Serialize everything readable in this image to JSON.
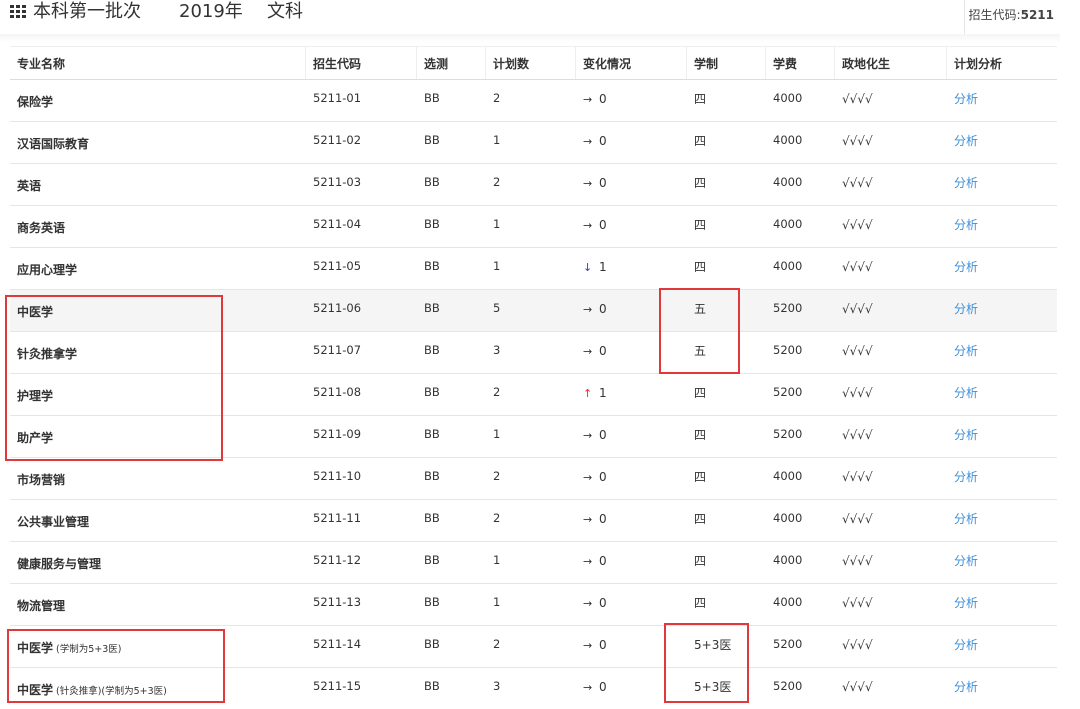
{
  "header": {
    "title": "本科第一批次",
    "year": "2019年",
    "subject": "文科",
    "code_label": "招生代码:",
    "code_value": "5211"
  },
  "table": {
    "columns": [
      "专业名称",
      "招生代码",
      "选测",
      "计划数",
      "变化情况",
      "学制",
      "学费",
      "政地化生",
      "计划分析"
    ],
    "rows": [
      {
        "name": "保险学",
        "note": "",
        "code": "5211-01",
        "test": "BB",
        "plan": "2",
        "change_dir": "flat",
        "change": "0",
        "years": "四",
        "fee": "4000",
        "subjects": "√√√√",
        "analysis": "分析"
      },
      {
        "name": "汉语国际教育",
        "note": "",
        "code": "5211-02",
        "test": "BB",
        "plan": "1",
        "change_dir": "flat",
        "change": "0",
        "years": "四",
        "fee": "4000",
        "subjects": "√√√√",
        "analysis": "分析"
      },
      {
        "name": "英语",
        "note": "",
        "code": "5211-03",
        "test": "BB",
        "plan": "2",
        "change_dir": "flat",
        "change": "0",
        "years": "四",
        "fee": "4000",
        "subjects": "√√√√",
        "analysis": "分析"
      },
      {
        "name": "商务英语",
        "note": "",
        "code": "5211-04",
        "test": "BB",
        "plan": "1",
        "change_dir": "flat",
        "change": "0",
        "years": "四",
        "fee": "4000",
        "subjects": "√√√√",
        "analysis": "分析"
      },
      {
        "name": "应用心理学",
        "note": "",
        "code": "5211-05",
        "test": "BB",
        "plan": "1",
        "change_dir": "down",
        "change": "1",
        "years": "四",
        "fee": "4000",
        "subjects": "√√√√",
        "analysis": "分析"
      },
      {
        "name": "中医学",
        "note": "",
        "code": "5211-06",
        "test": "BB",
        "plan": "5",
        "change_dir": "flat",
        "change": "0",
        "years": "五",
        "fee": "5200",
        "subjects": "√√√√",
        "analysis": "分析"
      },
      {
        "name": "针灸推拿学",
        "note": "",
        "code": "5211-07",
        "test": "BB",
        "plan": "3",
        "change_dir": "flat",
        "change": "0",
        "years": "五",
        "fee": "5200",
        "subjects": "√√√√",
        "analysis": "分析"
      },
      {
        "name": "护理学",
        "note": "",
        "code": "5211-08",
        "test": "BB",
        "plan": "2",
        "change_dir": "up",
        "change": "1",
        "years": "四",
        "fee": "5200",
        "subjects": "√√√√",
        "analysis": "分析"
      },
      {
        "name": "助产学",
        "note": "",
        "code": "5211-09",
        "test": "BB",
        "plan": "1",
        "change_dir": "flat",
        "change": "0",
        "years": "四",
        "fee": "5200",
        "subjects": "√√√√",
        "analysis": "分析"
      },
      {
        "name": "市场营销",
        "note": "",
        "code": "5211-10",
        "test": "BB",
        "plan": "2",
        "change_dir": "flat",
        "change": "0",
        "years": "四",
        "fee": "4000",
        "subjects": "√√√√",
        "analysis": "分析"
      },
      {
        "name": "公共事业管理",
        "note": "",
        "code": "5211-11",
        "test": "BB",
        "plan": "2",
        "change_dir": "flat",
        "change": "0",
        "years": "四",
        "fee": "4000",
        "subjects": "√√√√",
        "analysis": "分析"
      },
      {
        "name": "健康服务与管理",
        "note": "",
        "code": "5211-12",
        "test": "BB",
        "plan": "1",
        "change_dir": "flat",
        "change": "0",
        "years": "四",
        "fee": "4000",
        "subjects": "√√√√",
        "analysis": "分析"
      },
      {
        "name": "物流管理",
        "note": "",
        "code": "5211-13",
        "test": "BB",
        "plan": "1",
        "change_dir": "flat",
        "change": "0",
        "years": "四",
        "fee": "4000",
        "subjects": "√√√√",
        "analysis": "分析"
      },
      {
        "name": "中医学",
        "note": "(学制为5+3医)",
        "code": "5211-14",
        "test": "BB",
        "plan": "2",
        "change_dir": "flat",
        "change": "0",
        "years": "5+3医",
        "fee": "5200",
        "subjects": "√√√√",
        "analysis": "分析"
      },
      {
        "name": "中医学",
        "note": "(针灸推拿)(学制为5+3医)",
        "code": "5211-15",
        "test": "BB",
        "plan": "3",
        "change_dir": "flat",
        "change": "0",
        "years": "5+3医",
        "fee": "5200",
        "subjects": "√√√√",
        "analysis": "分析"
      }
    ]
  },
  "icons": {
    "menu": "grid-menu-icon",
    "arrows": {
      "flat": "→",
      "down": "↓",
      "up": "↑"
    }
  },
  "colors": {
    "link": "#3f8fd8",
    "highlight_box": "#e0393b",
    "arrow_up": "#e03030",
    "arrow_down": "#2e3fd0"
  }
}
